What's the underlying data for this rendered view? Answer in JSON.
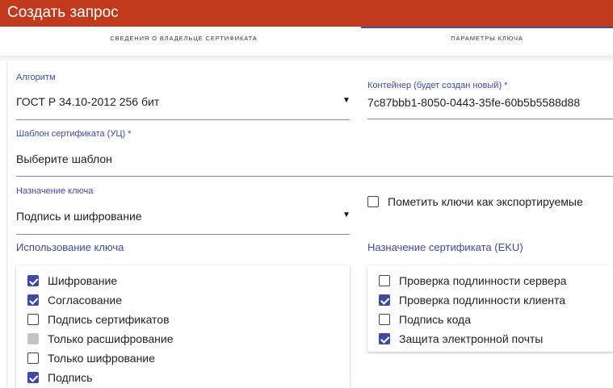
{
  "header": {
    "title": "Создать запрос"
  },
  "tabs": [
    {
      "label": "СВЕДЕНИЯ О ВЛАДЕЛЬЦЕ СЕРТИФИКАТА"
    },
    {
      "label": "ПАРАМЕТРЫ КЛЮЧА",
      "active": true
    }
  ],
  "form": {
    "algorithm": {
      "label": "Алгоритм",
      "value": "ГОСТ Р 34.10-2012 256 бит"
    },
    "container": {
      "label": "Контейнер (будет создан новый) *",
      "value": "7c87bbb1-8050-0443-35fe-60b5b5588d88"
    },
    "template": {
      "label": "Шаблон сертификата (УЦ) *",
      "placeholder": "Выберите шаблон"
    },
    "key_purpose": {
      "label": "Назначение ключа",
      "value": "Подпись и шифрование"
    },
    "exportable": {
      "label": "Пометить ключи как экспортируемые",
      "checked": false
    }
  },
  "key_usage": {
    "title": "Использование ключа",
    "items": [
      {
        "label": "Шифрование",
        "checked": true
      },
      {
        "label": "Согласование",
        "checked": true
      },
      {
        "label": "Подпись сертификатов",
        "checked": false
      },
      {
        "label": "Только расшифрование",
        "checked": false,
        "disabled": true
      },
      {
        "label": "Только шифрование",
        "checked": false
      },
      {
        "label": "Подпись",
        "checked": true
      }
    ]
  },
  "eku": {
    "title": "Назначение сертификата (EKU)",
    "items": [
      {
        "label": "Проверка подлинности сервера",
        "checked": false
      },
      {
        "label": "Проверка подлинности клиента",
        "checked": true
      },
      {
        "label": "Подпись кода",
        "checked": false
      },
      {
        "label": "Защита электронной почты",
        "checked": true
      }
    ]
  },
  "colors": {
    "header": "#c23a1e",
    "accent": "#3f4aa8",
    "disabled": "#c4c4c4"
  },
  "icons": {
    "dropdown": "caret-down-icon",
    "checkbox": "checkbox-icon"
  }
}
